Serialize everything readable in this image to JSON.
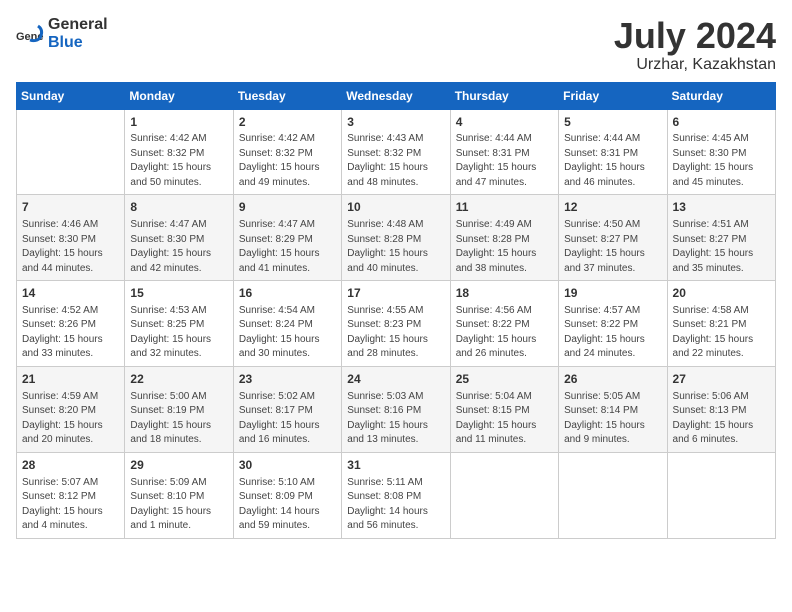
{
  "header": {
    "logo_general": "General",
    "logo_blue": "Blue",
    "month_title": "July 2024",
    "location": "Urzhar, Kazakhstan"
  },
  "days_of_week": [
    "Sunday",
    "Monday",
    "Tuesday",
    "Wednesday",
    "Thursday",
    "Friday",
    "Saturday"
  ],
  "weeks": [
    [
      {
        "day": "",
        "content": ""
      },
      {
        "day": "1",
        "content": "Sunrise: 4:42 AM\nSunset: 8:32 PM\nDaylight: 15 hours\nand 50 minutes."
      },
      {
        "day": "2",
        "content": "Sunrise: 4:42 AM\nSunset: 8:32 PM\nDaylight: 15 hours\nand 49 minutes."
      },
      {
        "day": "3",
        "content": "Sunrise: 4:43 AM\nSunset: 8:32 PM\nDaylight: 15 hours\nand 48 minutes."
      },
      {
        "day": "4",
        "content": "Sunrise: 4:44 AM\nSunset: 8:31 PM\nDaylight: 15 hours\nand 47 minutes."
      },
      {
        "day": "5",
        "content": "Sunrise: 4:44 AM\nSunset: 8:31 PM\nDaylight: 15 hours\nand 46 minutes."
      },
      {
        "day": "6",
        "content": "Sunrise: 4:45 AM\nSunset: 8:30 PM\nDaylight: 15 hours\nand 45 minutes."
      }
    ],
    [
      {
        "day": "7",
        "content": "Sunrise: 4:46 AM\nSunset: 8:30 PM\nDaylight: 15 hours\nand 44 minutes."
      },
      {
        "day": "8",
        "content": "Sunrise: 4:47 AM\nSunset: 8:30 PM\nDaylight: 15 hours\nand 42 minutes."
      },
      {
        "day": "9",
        "content": "Sunrise: 4:47 AM\nSunset: 8:29 PM\nDaylight: 15 hours\nand 41 minutes."
      },
      {
        "day": "10",
        "content": "Sunrise: 4:48 AM\nSunset: 8:28 PM\nDaylight: 15 hours\nand 40 minutes."
      },
      {
        "day": "11",
        "content": "Sunrise: 4:49 AM\nSunset: 8:28 PM\nDaylight: 15 hours\nand 38 minutes."
      },
      {
        "day": "12",
        "content": "Sunrise: 4:50 AM\nSunset: 8:27 PM\nDaylight: 15 hours\nand 37 minutes."
      },
      {
        "day": "13",
        "content": "Sunrise: 4:51 AM\nSunset: 8:27 PM\nDaylight: 15 hours\nand 35 minutes."
      }
    ],
    [
      {
        "day": "14",
        "content": "Sunrise: 4:52 AM\nSunset: 8:26 PM\nDaylight: 15 hours\nand 33 minutes."
      },
      {
        "day": "15",
        "content": "Sunrise: 4:53 AM\nSunset: 8:25 PM\nDaylight: 15 hours\nand 32 minutes."
      },
      {
        "day": "16",
        "content": "Sunrise: 4:54 AM\nSunset: 8:24 PM\nDaylight: 15 hours\nand 30 minutes."
      },
      {
        "day": "17",
        "content": "Sunrise: 4:55 AM\nSunset: 8:23 PM\nDaylight: 15 hours\nand 28 minutes."
      },
      {
        "day": "18",
        "content": "Sunrise: 4:56 AM\nSunset: 8:22 PM\nDaylight: 15 hours\nand 26 minutes."
      },
      {
        "day": "19",
        "content": "Sunrise: 4:57 AM\nSunset: 8:22 PM\nDaylight: 15 hours\nand 24 minutes."
      },
      {
        "day": "20",
        "content": "Sunrise: 4:58 AM\nSunset: 8:21 PM\nDaylight: 15 hours\nand 22 minutes."
      }
    ],
    [
      {
        "day": "21",
        "content": "Sunrise: 4:59 AM\nSunset: 8:20 PM\nDaylight: 15 hours\nand 20 minutes."
      },
      {
        "day": "22",
        "content": "Sunrise: 5:00 AM\nSunset: 8:19 PM\nDaylight: 15 hours\nand 18 minutes."
      },
      {
        "day": "23",
        "content": "Sunrise: 5:02 AM\nSunset: 8:17 PM\nDaylight: 15 hours\nand 16 minutes."
      },
      {
        "day": "24",
        "content": "Sunrise: 5:03 AM\nSunset: 8:16 PM\nDaylight: 15 hours\nand 13 minutes."
      },
      {
        "day": "25",
        "content": "Sunrise: 5:04 AM\nSunset: 8:15 PM\nDaylight: 15 hours\nand 11 minutes."
      },
      {
        "day": "26",
        "content": "Sunrise: 5:05 AM\nSunset: 8:14 PM\nDaylight: 15 hours\nand 9 minutes."
      },
      {
        "day": "27",
        "content": "Sunrise: 5:06 AM\nSunset: 8:13 PM\nDaylight: 15 hours\nand 6 minutes."
      }
    ],
    [
      {
        "day": "28",
        "content": "Sunrise: 5:07 AM\nSunset: 8:12 PM\nDaylight: 15 hours\nand 4 minutes."
      },
      {
        "day": "29",
        "content": "Sunrise: 5:09 AM\nSunset: 8:10 PM\nDaylight: 15 hours\nand 1 minute."
      },
      {
        "day": "30",
        "content": "Sunrise: 5:10 AM\nSunset: 8:09 PM\nDaylight: 14 hours\nand 59 minutes."
      },
      {
        "day": "31",
        "content": "Sunrise: 5:11 AM\nSunset: 8:08 PM\nDaylight: 14 hours\nand 56 minutes."
      },
      {
        "day": "",
        "content": ""
      },
      {
        "day": "",
        "content": ""
      },
      {
        "day": "",
        "content": ""
      }
    ]
  ]
}
